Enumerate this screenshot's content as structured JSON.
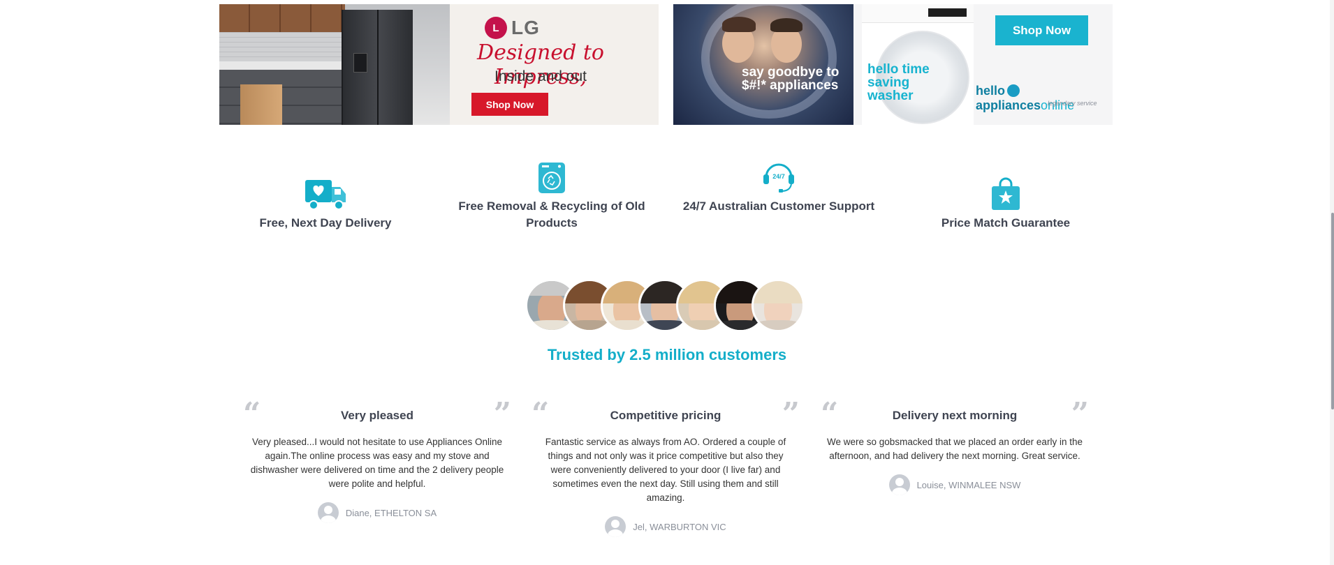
{
  "banners": {
    "lg": {
      "brand": "LG",
      "tagline": "Designed to Impress,",
      "subline": "Inside and out",
      "button": "Shop Now"
    },
    "ao": {
      "left_text": "say goodbye to $#!* appliances",
      "middle_text": "hello time saving washer",
      "button": "Shop Now",
      "logo_prefix": "hello",
      "logo_main": "appliances",
      "logo_suffix": "online",
      "logo_tagline": "legendary service"
    }
  },
  "features": [
    {
      "label": "Free, Next Day Delivery",
      "icon": "delivery-truck-icon"
    },
    {
      "label": "Free Removal & Recycling of Old Products",
      "icon": "recycle-washer-icon"
    },
    {
      "label": "24/7 Australian Customer Support",
      "icon": "headset-icon",
      "icon_text": "24/7"
    },
    {
      "label": "Price Match Guarantee",
      "icon": "shopping-bag-star-icon"
    }
  ],
  "trust": {
    "headline": "Trusted by 2.5 million customers"
  },
  "reviews": [
    {
      "title": "Very pleased",
      "body": "Very pleased...I would not hesitate to use Appliances Online again.The online process was easy and my stove and dishwasher were delivered on time and the 2 delivery people were polite and helpful.",
      "author": "Diane, ETHELTON SA"
    },
    {
      "title": "Competitive pricing",
      "body": "Fantastic service as always from AO. Ordered a couple of things and not only was it price competitive but also they were conveniently delivered to your door (I live far) and sometimes even the next day. Still using them and still amazing.",
      "author": "Jel, WARBURTON VIC"
    },
    {
      "title": "Delivery next morning",
      "body": "We were so gobsmacked that we placed an order early in the afternoon, and had delivery the next morning. Great service.",
      "author": "Louise, WINMALEE NSW"
    }
  ],
  "colors": {
    "accent": "#14aec9",
    "lg_red": "#d7182a",
    "text": "#3f4451"
  }
}
